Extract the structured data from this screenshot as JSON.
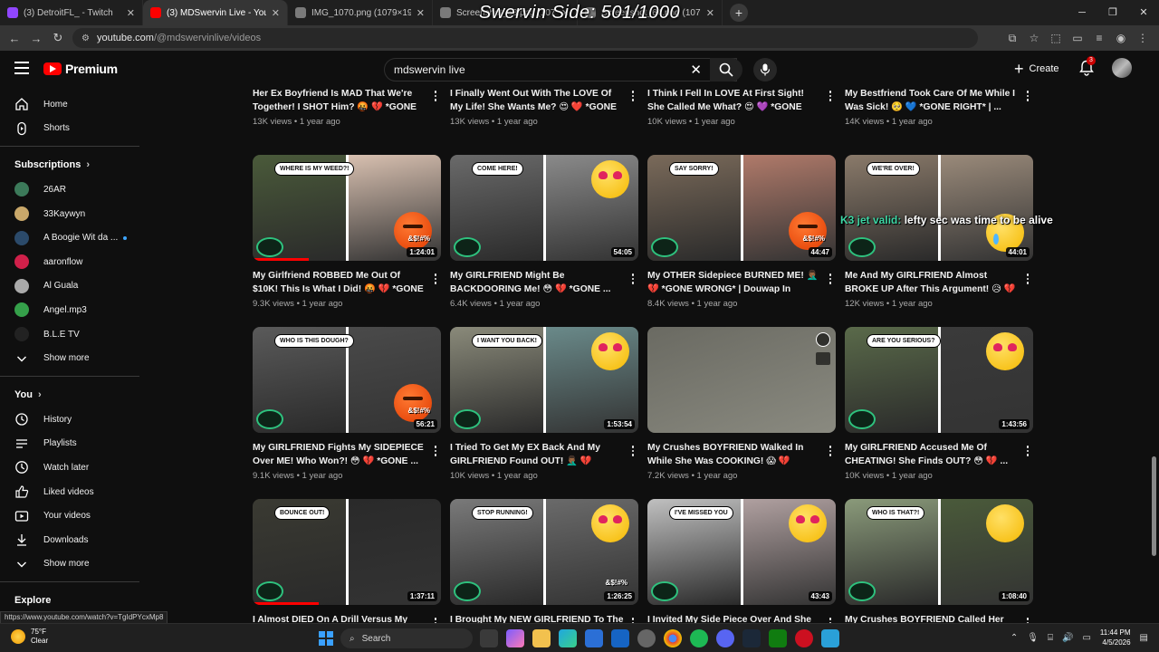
{
  "overlay_title": "Swervin Side: 501/1000",
  "browser": {
    "tabs": [
      {
        "label": "(3) DetroitFL_ - Twitch",
        "color": "#9146ff",
        "active": false
      },
      {
        "label": "(3) MDSwervin Live - YouTube",
        "color": "#ff0000",
        "active": true
      },
      {
        "label": "IMG_1070.png (1079×1919)",
        "color": "#7a7a7a",
        "active": false
      },
      {
        "label": "Screenshot_63.png (1079×1919)",
        "color": "#7a7a7a",
        "active": false
      },
      {
        "label": "Screenshot_64.png (1079×1919)",
        "color": "#7a7a7a",
        "active": false
      }
    ],
    "url_host": "youtube.com",
    "url_path": "/@mdswervinlive/videos"
  },
  "youtube": {
    "logo_text": "Premium",
    "search_value": "mdswervin live",
    "create_label": "Create",
    "notifications_count": "3"
  },
  "sidebar": {
    "main": [
      {
        "label": "Home",
        "icon": "home-icon"
      },
      {
        "label": "Shorts",
        "icon": "shorts-icon"
      }
    ],
    "subscriptions_title": "Subscriptions",
    "subscriptions": [
      {
        "label": "26AR",
        "color": "#3c7a5a"
      },
      {
        "label": "33Kaywyn",
        "color": "#c9a86a"
      },
      {
        "label": "A Boogie Wit da ...",
        "color": "#2b4a6a",
        "live": true
      },
      {
        "label": "aaronflow",
        "color": "#d0204a"
      },
      {
        "label": "Al Guala",
        "color": "#aaaaaa"
      },
      {
        "label": "Angel.mp3",
        "color": "#35a04a"
      },
      {
        "label": "B.L.E TV",
        "color": "#222222"
      }
    ],
    "show_more": "Show more",
    "you_title": "You",
    "you": [
      {
        "label": "History",
        "icon": "history-icon"
      },
      {
        "label": "Playlists",
        "icon": "playlists-icon"
      },
      {
        "label": "Watch later",
        "icon": "watch-later-icon"
      },
      {
        "label": "Liked videos",
        "icon": "thumbs-up-icon"
      },
      {
        "label": "Your videos",
        "icon": "your-videos-icon"
      },
      {
        "label": "Downloads",
        "icon": "download-icon"
      }
    ],
    "show_more_2": "Show more",
    "explore_title": "Explore"
  },
  "previous_row": [
    {
      "title": "Her Ex Boyfriend Is MAD That We're Together! I SHOT Him? 🤬 💔 *GONE ...",
      "meta": "13K views • 1 year ago"
    },
    {
      "title": "I Finally Went Out With The LOVE Of My Life! She Wants Me? 😍 ❤️ *GONE ...",
      "meta": "13K views • 1 year ago"
    },
    {
      "title": "I Think I Fell In LOVE At First Sight! She Called Me What? 😍 💜 *GONE RIGHT...",
      "meta": "10K views • 1 year ago"
    },
    {
      "title": "My Bestfriend Took Care Of Me While I Was Sick! 🥺 💙 *GONE RIGHT* | ...",
      "meta": "14K views • 1 year ago"
    }
  ],
  "videos": [
    [
      {
        "title": "My Girlfriend ROBBED Me Out Of $10K! This Is What I Did! 🤬 💔 *GONE ...",
        "meta": "9.3K views • 1 year ago",
        "duration": "1:24:01",
        "bubble": "WHERE IS MY WEED?!",
        "emoji": "angry",
        "curse": "&$!#%",
        "c1": "#4a5a3a",
        "c2": "#d8c0b0",
        "progress": 0.3
      },
      {
        "title": "My GIRLFRIEND Might Be BACKDOORING Me! 😳 💔 *GONE ...",
        "meta": "6.4K views • 1 year ago",
        "duration": "54:05",
        "bubble": "COME HERE!",
        "emoji": "love",
        "curse": "",
        "c1": "#6a6a6a",
        "c2": "#8a8a8a",
        "progress": 0
      },
      {
        "title": "My OTHER Sidepiece BURNED ME! 🤦🏾‍♂️ 💔 *GONE WRONG* | Douwap In Wind...",
        "meta": "8.4K views • 1 year ago",
        "duration": "44:47",
        "bubble": "SAY SORRY!",
        "emoji": "angry",
        "curse": "&$!#%",
        "c1": "#7a6a5a",
        "c2": "#b07a6a",
        "progress": 0
      },
      {
        "title": "Me And My GIRLFRIEND Almost BROKE UP After This Argument! 😥 💔 *GONE...",
        "meta": "12K views • 1 year ago",
        "duration": "44:01",
        "bubble": "WE'RE OVER!",
        "emoji": "tear",
        "curse": "",
        "c1": "#8a7a6a",
        "c2": "#9a8a7a",
        "progress": 0
      }
    ],
    [
      {
        "title": "My GIRLFRIEND Fights My SIDEPIECE Over ME! Who Won?! 😳 💔 *GONE ...",
        "meta": "9.1K views • 1 year ago",
        "duration": "56:21",
        "bubble": "WHO IS THIS DOUGH?",
        "emoji": "angry",
        "curse": "&$!#%",
        "c1": "#5a5a5a",
        "c2": "#4a4a4a",
        "progress": 0
      },
      {
        "title": "I Tried To Get My EX Back And My GIRLFRIEND Found OUT! 🤦🏾‍♂️ 💔 *GON...",
        "meta": "10K views • 1 year ago",
        "duration": "1:53:54",
        "bubble": "I WANT YOU BACK!",
        "emoji": "love",
        "curse": "",
        "c1": "#8a8a7a",
        "c2": "#6a8a8a",
        "progress": 0
      },
      {
        "title": "My Crushes BOYFRIEND Walked In While She Was COOKING! 😱 💔 *GON...",
        "meta": "7.2K views • 1 year ago",
        "duration": "",
        "bubble": "",
        "emoji": "",
        "curse": "",
        "c1": "#6a6a62",
        "c2": "#8a8a80",
        "progress": 0,
        "hovered": true
      },
      {
        "title": "My GIRLFRIEND Accused Me Of CHEATING! She Finds OUT? 😳 💔 ...",
        "meta": "10K views • 1 year ago",
        "duration": "1:43:56",
        "bubble": "ARE YOU SERIOUS?",
        "emoji": "love",
        "curse": "",
        "c1": "#5a6a4a",
        "c2": "#3a3a3a",
        "progress": 0
      }
    ],
    [
      {
        "title": "I Almost DIED On A Drill Versus My",
        "meta": "",
        "duration": "1:37:11",
        "bubble": "BOUNCE OUT!",
        "emoji": "",
        "curse": "",
        "c1": "#3a3a32",
        "c2": "#2a2a2a",
        "progress": 0.35
      },
      {
        "title": "I Brought My NEW GIRLFRIEND To The",
        "meta": "",
        "duration": "1:26:25",
        "bubble": "STOP RUNNING!",
        "emoji": "love",
        "curse": "&$!#%",
        "c1": "#7a7a7a",
        "c2": "#6a6a6a",
        "progress": 0
      },
      {
        "title": "I Invited My Side Piece Over And She",
        "meta": "",
        "duration": "43:43",
        "bubble": "I'VE MISSED YOU",
        "emoji": "love",
        "curse": "",
        "c1": "#c0c0c0",
        "c2": "#b0a0a0",
        "progress": 0
      },
      {
        "title": "My Crushes BOYFRIEND Called Her",
        "meta": "",
        "duration": "1:08:40",
        "bubble": "WHO IS THAT?!",
        "emoji": "smirk",
        "curse": "",
        "c1": "#8a9a7a",
        "c2": "#4a5a3a",
        "progress": 0
      }
    ]
  ],
  "chat_overlay": {
    "name": "K3 jet valid:",
    "message": "lefty sec was time to be alive"
  },
  "status_link": "https://www.youtube.com/watch?v=TgIdPYcxMp8",
  "taskbar": {
    "temp": "75°F",
    "weather": "Clear",
    "search_label": "Search",
    "time": "11:44 PM",
    "date": "4/5/2026"
  }
}
